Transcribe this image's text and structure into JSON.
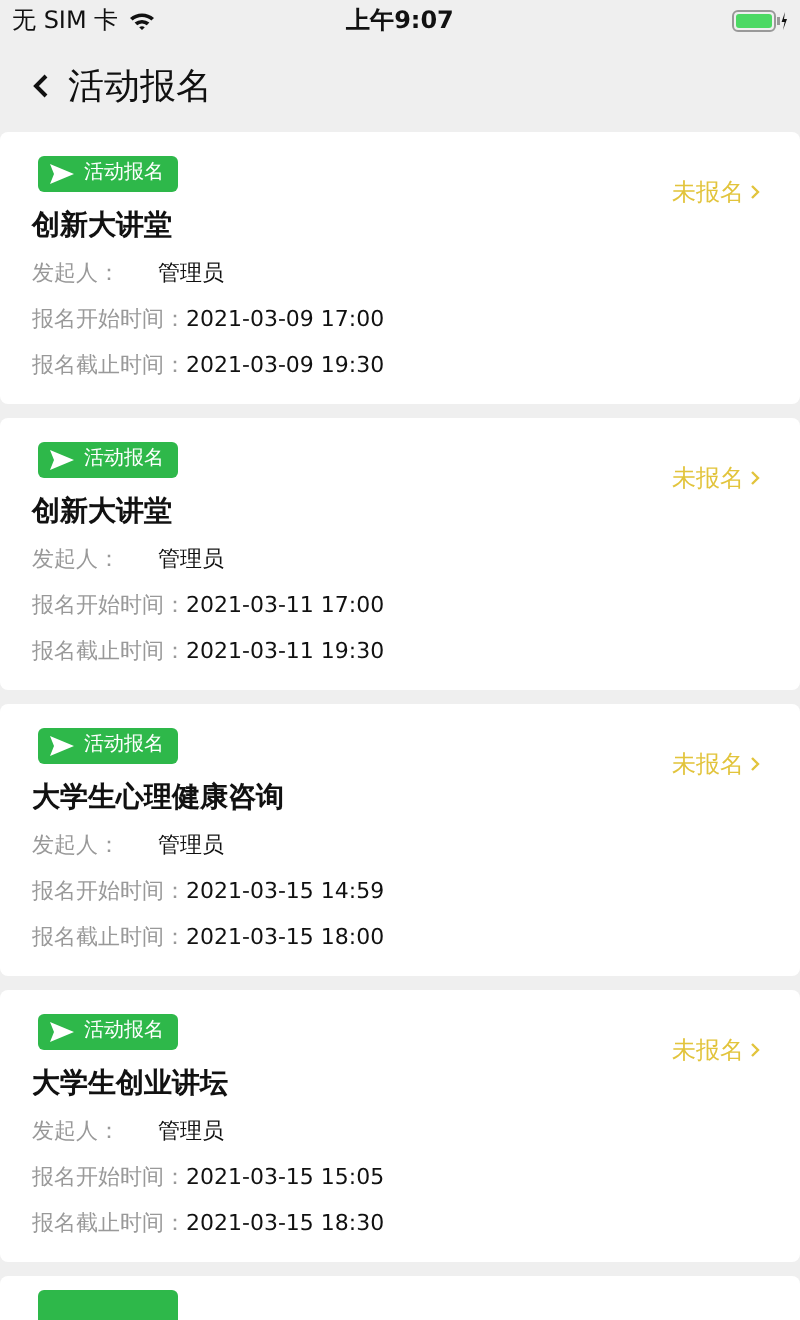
{
  "status_bar": {
    "carrier": "无 SIM 卡",
    "time": "上午9:07"
  },
  "header": {
    "title": "活动报名"
  },
  "activities": [
    {
      "tag": "活动报名",
      "title": "创新大讲堂",
      "status": "未报名",
      "organizer_label": "发起人：",
      "organizer": "管理员",
      "start_label": "报名开始时间：",
      "start": "2021-03-09 17:00",
      "end_label": "报名截止时间：",
      "end": "2021-03-09 19:30"
    },
    {
      "tag": "活动报名",
      "title": "创新大讲堂",
      "status": "未报名",
      "organizer_label": "发起人：",
      "organizer": "管理员",
      "start_label": "报名开始时间：",
      "start": "2021-03-11 17:00",
      "end_label": "报名截止时间：",
      "end": "2021-03-11 19:30"
    },
    {
      "tag": "活动报名",
      "title": "大学生心理健康咨询",
      "status": "未报名",
      "organizer_label": "发起人：",
      "organizer": "管理员",
      "start_label": "报名开始时间：",
      "start": "2021-03-15 14:59",
      "end_label": "报名截止时间：",
      "end": "2021-03-15 18:00"
    },
    {
      "tag": "活动报名",
      "title": "大学生创业讲坛",
      "status": "未报名",
      "organizer_label": "发起人：",
      "organizer": "管理员",
      "start_label": "报名开始时间：",
      "start": "2021-03-15 15:05",
      "end_label": "报名截止时间：",
      "end": "2021-03-15 18:30"
    }
  ]
}
